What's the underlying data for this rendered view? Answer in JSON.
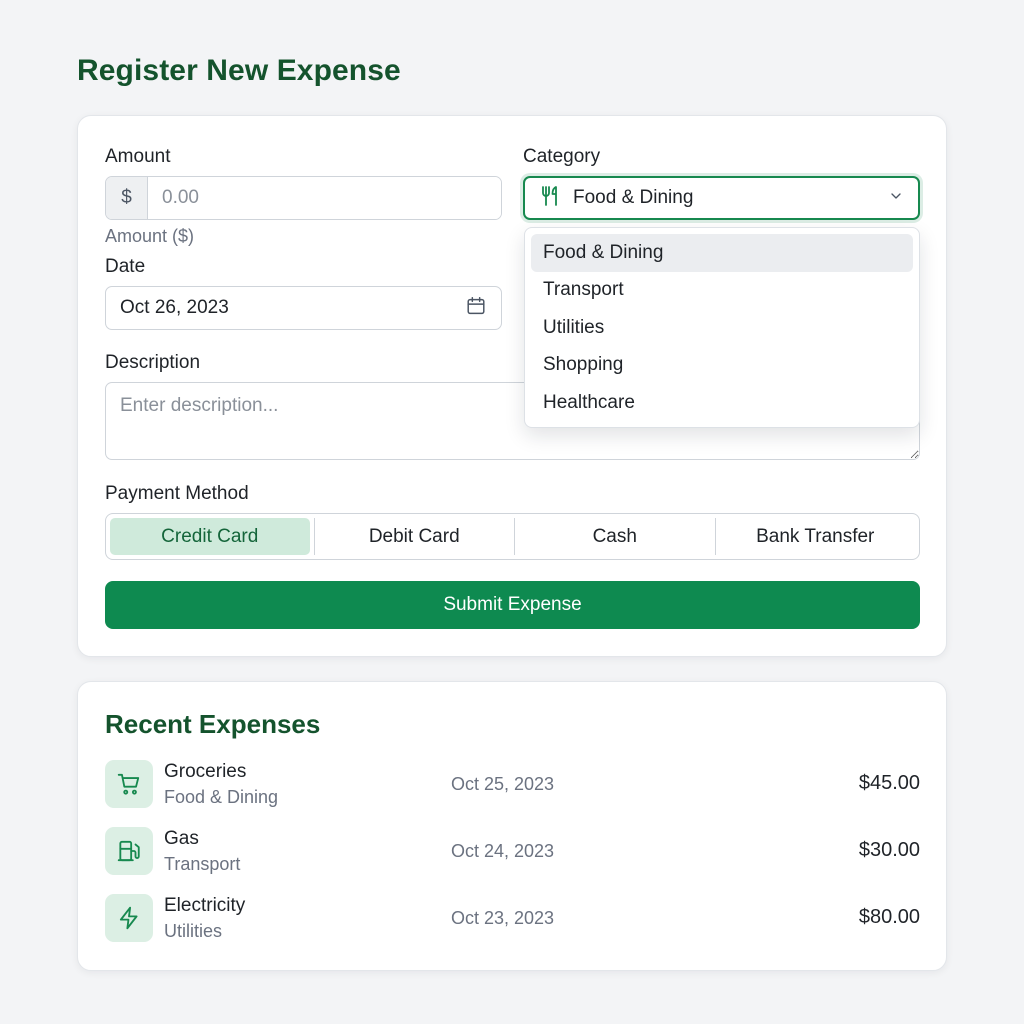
{
  "page": {
    "title": "Register New Expense"
  },
  "form": {
    "amount_label": "Amount",
    "amount_prefix": "$",
    "amount_placeholder": "0.00",
    "amount_hint": "Amount ($)",
    "date_label": "Date",
    "date_value": "Oct 26, 2023",
    "description_label": "Description",
    "description_placeholder": "Enter description...",
    "category_label": "Category",
    "category_selected": "Food & Dining",
    "category_options": [
      "Food & Dining",
      "Transport",
      "Utilities",
      "Shopping",
      "Healthcare"
    ],
    "payment_label": "Payment Method",
    "payment_options": [
      "Credit Card",
      "Debit Card",
      "Cash",
      "Bank Transfer"
    ],
    "payment_selected": "Credit Card",
    "submit_label": "Submit Expense"
  },
  "recent": {
    "title": "Recent Expenses",
    "items": [
      {
        "name": "Groceries",
        "category": "Food & Dining",
        "date": "Oct 25, 2023",
        "amount": "$45.00",
        "icon": "shopping-cart-icon"
      },
      {
        "name": "Gas",
        "category": "Transport",
        "date": "Oct 24, 2023",
        "amount": "$30.00",
        "icon": "fuel-pump-icon"
      },
      {
        "name": "Electricity",
        "category": "Utilities",
        "date": "Oct 23, 2023",
        "amount": "$80.00",
        "icon": "lightning-bolt-icon"
      }
    ]
  },
  "colors": {
    "accent": "#0e8a50",
    "heading": "#14532d",
    "selected_bg": "#cfeadb",
    "icon_bg": "#dcefe4"
  }
}
